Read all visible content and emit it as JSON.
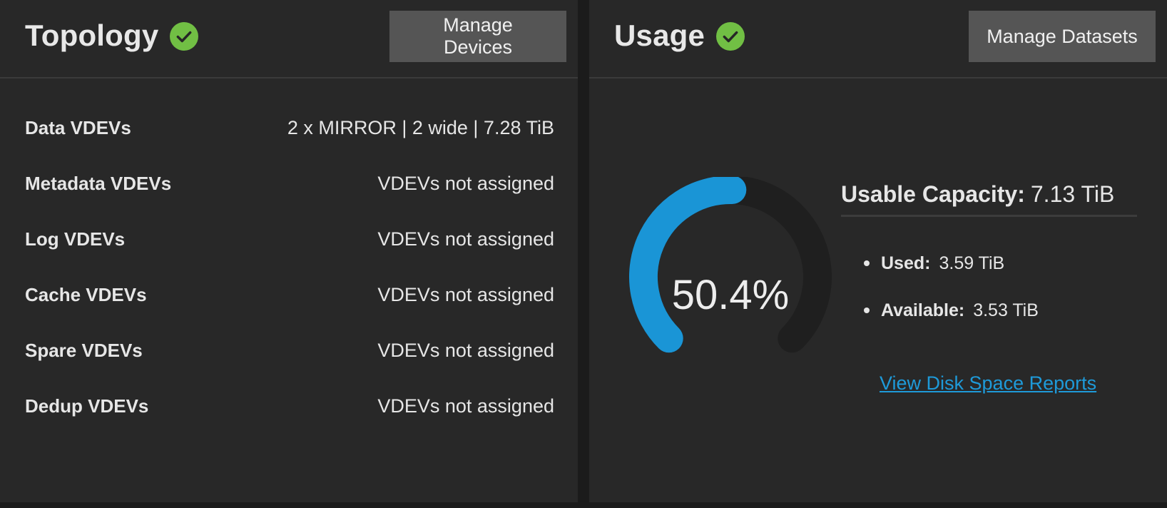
{
  "colors": {
    "background": "#1b1b1b",
    "card": "#282828",
    "accent": "#1a95d6",
    "success": "#71bf44",
    "button": "#555555",
    "link": "#1e9ad9"
  },
  "topology": {
    "title": "Topology",
    "status_icon": "check-circle-icon",
    "manage_button": "Manage Devices",
    "rows": [
      {
        "label": "Data VDEVs",
        "value": "2 x MIRROR | 2 wide | 7.28 TiB"
      },
      {
        "label": "Metadata VDEVs",
        "value": "VDEVs not assigned"
      },
      {
        "label": "Log VDEVs",
        "value": "VDEVs not assigned"
      },
      {
        "label": "Cache VDEVs",
        "value": "VDEVs not assigned"
      },
      {
        "label": "Spare VDEVs",
        "value": "VDEVs not assigned"
      },
      {
        "label": "Dedup VDEVs",
        "value": "VDEVs not assigned"
      }
    ]
  },
  "usage": {
    "title": "Usage",
    "status_icon": "check-circle-icon",
    "manage_button": "Manage Datasets",
    "gauge_percent": 50.4,
    "gauge_text": "50.4%",
    "capacity_label": "Usable Capacity:",
    "capacity_value": "7.13 TiB",
    "used_label": "Used:",
    "used_value": "3.59 TiB",
    "available_label": "Available:",
    "available_value": "3.53 TiB",
    "report_link": "View Disk Space Reports"
  }
}
